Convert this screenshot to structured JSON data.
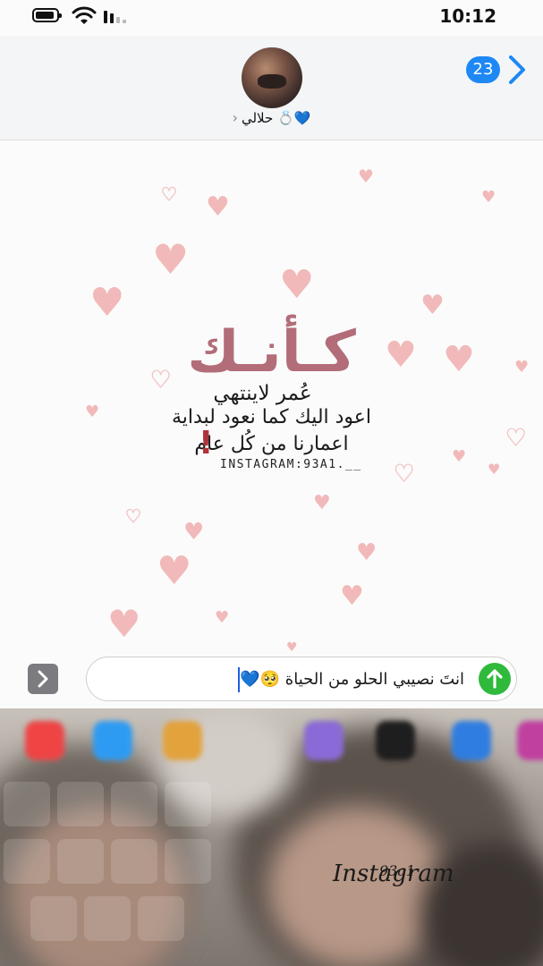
{
  "status_bar": {
    "time": "10:12"
  },
  "header": {
    "back_badge": "23",
    "contact_name": "حلالي 💍💙",
    "chevron": "›"
  },
  "message_image": {
    "big_word": "كـأنـك",
    "line1": "عُمر لاينتهي",
    "line2": "اعود اليك كما نعود لبداية",
    "line3": "اعمارنا من كُل عام",
    "exclaim": "!",
    "instagram": "INSTAGRAM:93A1.__"
  },
  "composer": {
    "text": "انتَ نصيبي الحلو من الحياة 🥺💙",
    "send_icon": "arrow-up-icon",
    "expand_icon": "chevron-right-icon"
  },
  "watermark": {
    "signature": "Instagram",
    "signature_small": "93a1"
  },
  "colors": {
    "accent_blue": "#1e88f5",
    "send_green": "#2fba3c",
    "title_rose": "#b26d79",
    "heart_pink": "#f1b9b9"
  }
}
